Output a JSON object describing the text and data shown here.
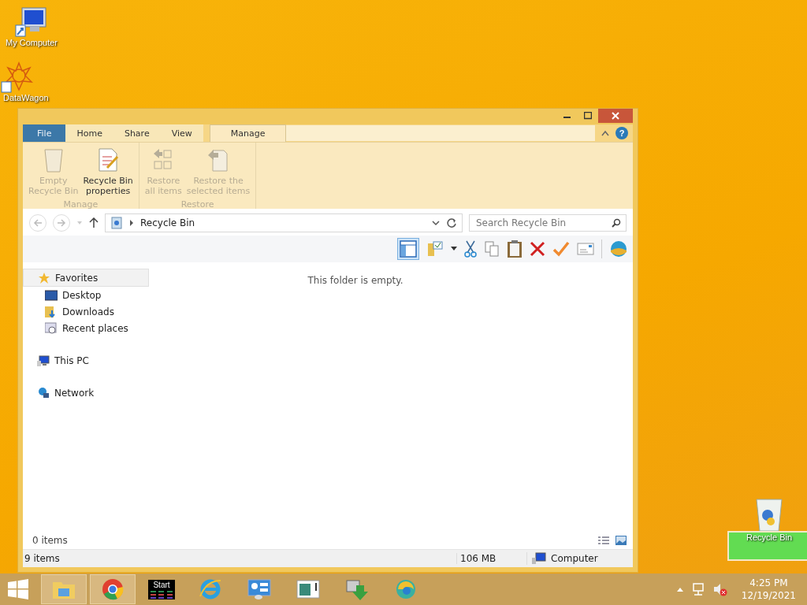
{
  "desktop_icons": [
    {
      "label": "My Computer",
      "kind": "computer"
    },
    {
      "label": "DataWagon",
      "kind": "star"
    },
    {
      "label": "Recycle Bin",
      "kind": "bin"
    }
  ],
  "window": {
    "ribbon_tabs": [
      {
        "label": "File",
        "kind": "file",
        "selected": false
      },
      {
        "label": "Home",
        "kind": "tab",
        "selected": false
      },
      {
        "label": "Share",
        "kind": "tab",
        "selected": false
      },
      {
        "label": "View",
        "kind": "tab",
        "selected": false
      },
      {
        "label": "Manage",
        "kind": "tab",
        "selected": true
      }
    ],
    "ribbon_groups": [
      {
        "label": "Manage",
        "commands": [
          {
            "lines": [
              "Empty",
              "Recycle Bin"
            ],
            "kind": "bin",
            "disabled": true
          },
          {
            "lines": [
              "Recycle Bin",
              "properties"
            ],
            "kind": "props",
            "disabled": false
          }
        ]
      },
      {
        "label": "Restore",
        "commands": [
          {
            "lines": [
              "Restore",
              "all items"
            ],
            "kind": "restore-all",
            "disabled": true
          },
          {
            "lines": [
              "Restore the",
              "selected items"
            ],
            "kind": "restore-sel",
            "disabled": true
          }
        ]
      }
    ],
    "address": "Recycle Bin",
    "search": {
      "placeholder": "Search Recycle Bin"
    },
    "nav_pane": [
      {
        "label": "Favorites",
        "kind": "star",
        "selected": true,
        "children": [
          {
            "label": "Desktop",
            "kind": "desktop",
            "selected": false
          },
          {
            "label": "Downloads",
            "kind": "downloads",
            "selected": false
          },
          {
            "label": "Recent places",
            "kind": "recent",
            "selected": false
          }
        ]
      },
      {
        "label": "This PC",
        "kind": "pc",
        "selected": false
      },
      {
        "label": "Network",
        "kind": "network",
        "selected": false
      }
    ],
    "help_label": "?",
    "empty_message": "This folder is empty.",
    "item_count": "0 items",
    "status_bar": {
      "items": "9 items",
      "size": "106 MB",
      "zone": "Computer"
    }
  },
  "taskbar": {
    "apps": [
      {
        "kind": "explorer",
        "selected": true
      },
      {
        "kind": "chrome",
        "selected": true
      },
      {
        "kind": "start",
        "label": "Start",
        "selected": false
      },
      {
        "kind": "ie",
        "selected": false
      },
      {
        "kind": "control",
        "selected": false
      },
      {
        "kind": "doc",
        "selected": false
      },
      {
        "kind": "download",
        "selected": false
      },
      {
        "kind": "edge",
        "selected": false
      }
    ],
    "time": "4:25 PM",
    "date": "12/19/2021"
  }
}
